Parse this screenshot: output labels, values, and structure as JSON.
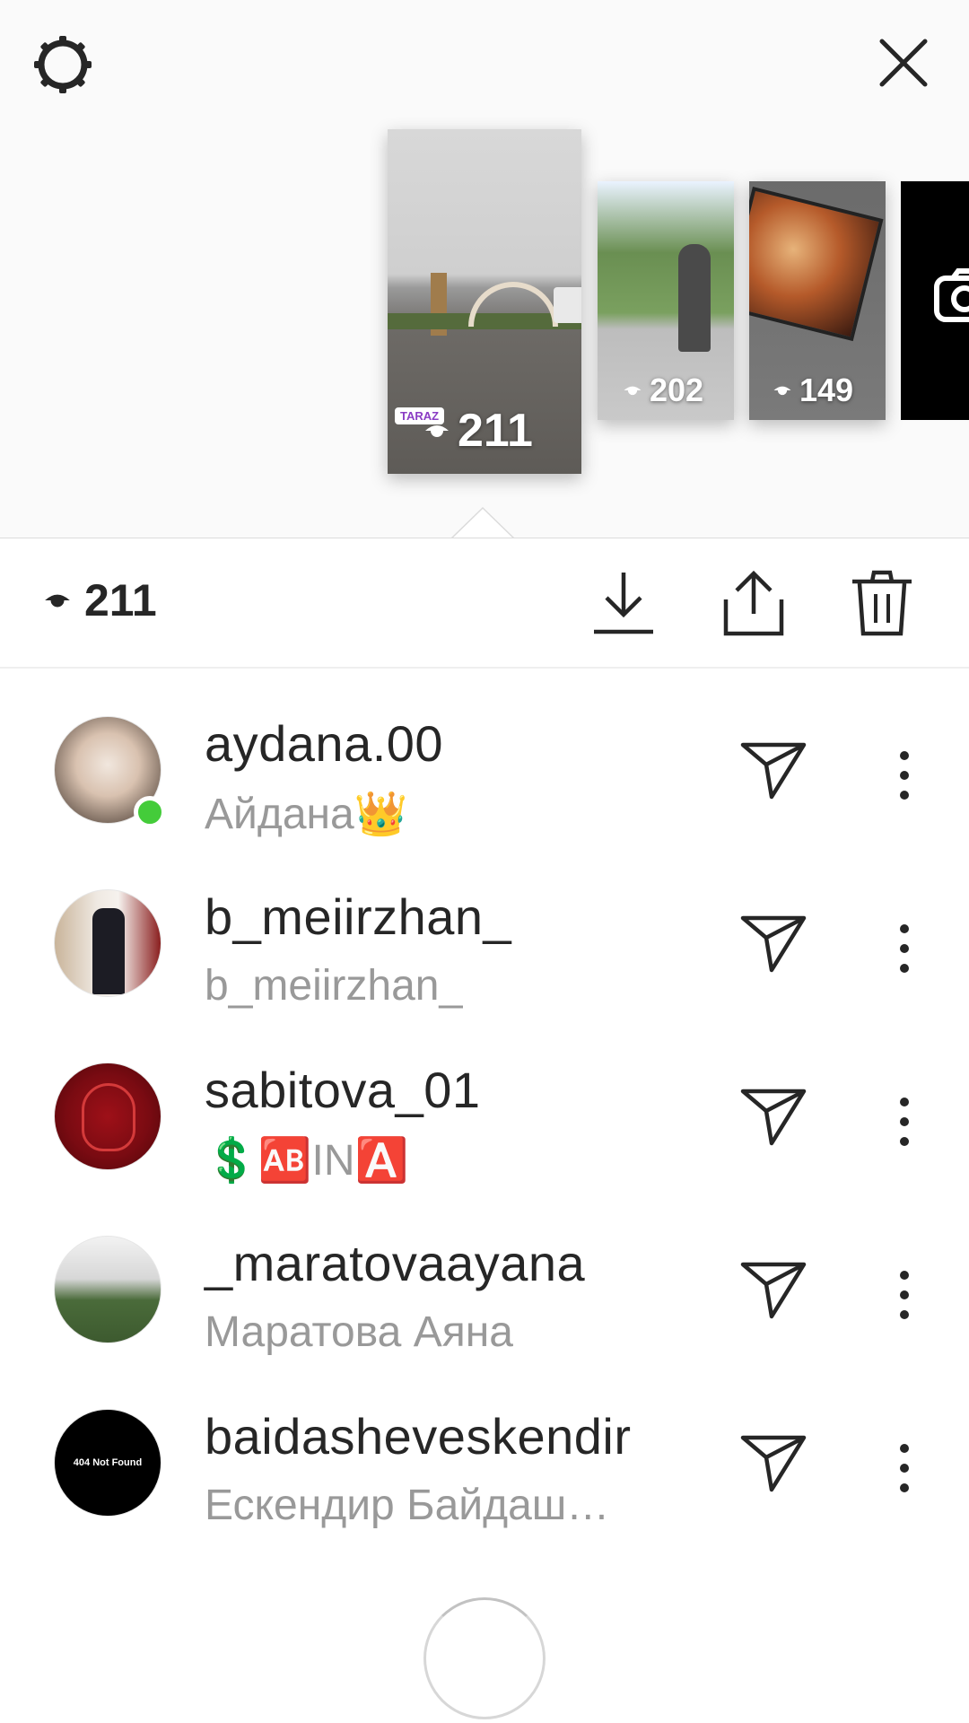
{
  "header": {
    "settings_icon": "gear-icon",
    "close_icon": "close-icon"
  },
  "stories": [
    {
      "views": "211",
      "tag": "TARAZ",
      "selected": true
    },
    {
      "views": "202"
    },
    {
      "views": "149"
    },
    {
      "type": "camera"
    }
  ],
  "toolbar": {
    "view_count": "211",
    "actions": [
      "download-icon",
      "share-icon",
      "delete-icon"
    ]
  },
  "viewers": [
    {
      "username": "aydana.00",
      "full_name": "Айдана👑",
      "online": true
    },
    {
      "username": "b_meiirzhan_",
      "full_name": "b_meiirzhan_",
      "online": false
    },
    {
      "username": "sabitova_01",
      "full_name": "💲🆎IN🅰️",
      "online": false
    },
    {
      "username": "_maratovaayana",
      "full_name": "Маратова Аяна",
      "online": false
    },
    {
      "username": "baidasheveskendir",
      "full_name": "Ескендир Байдаш…",
      "avatar_text": "404 Not Found",
      "online": false
    }
  ],
  "colors": {
    "online": "#44cc3a",
    "secondary_text": "#999999",
    "primary_text": "#262626"
  }
}
